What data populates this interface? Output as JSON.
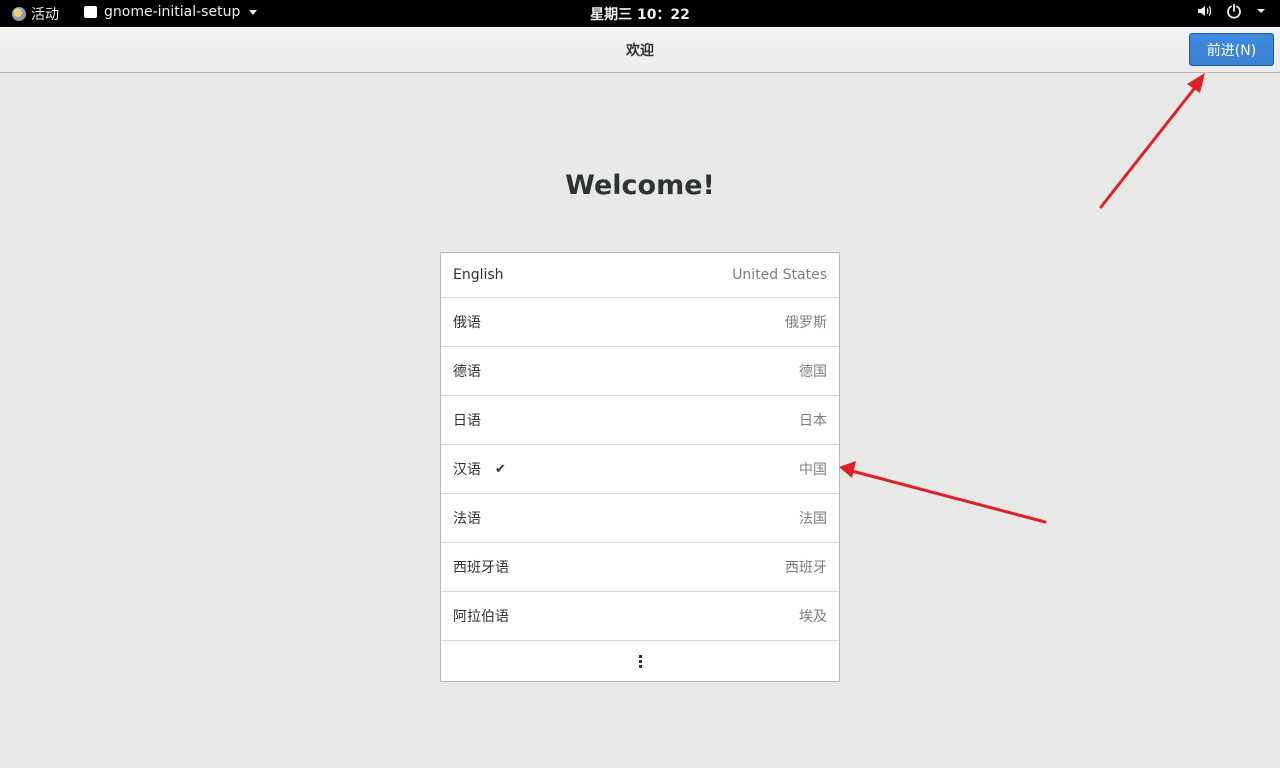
{
  "topbar": {
    "activities_label": "活动",
    "app_name": "gnome-initial-setup",
    "clock": "星期三 10：22",
    "icons": [
      "volume-icon",
      "power-icon",
      "chevron-down-icon"
    ]
  },
  "headerbar": {
    "title": "欢迎",
    "next_label": "前进(N)"
  },
  "main": {
    "welcome": "Welcome!",
    "languages": [
      {
        "language": "English",
        "region": "United States",
        "selected": false
      },
      {
        "language": "俄语",
        "region": "俄罗斯",
        "selected": false
      },
      {
        "language": "德语",
        "region": "德国",
        "selected": false
      },
      {
        "language": "日语",
        "region": "日本",
        "selected": false
      },
      {
        "language": "汉语",
        "region": "中国",
        "selected": true
      },
      {
        "language": "法语",
        "region": "法国",
        "selected": false
      },
      {
        "language": "西班牙语",
        "region": "西班牙",
        "selected": false
      },
      {
        "language": "阿拉伯语",
        "region": "埃及",
        "selected": false
      }
    ],
    "check_mark": "✔"
  },
  "colors": {
    "accent": "#3a80d3",
    "annotation_arrow": "#e02027",
    "background": "#e8e8e7"
  }
}
